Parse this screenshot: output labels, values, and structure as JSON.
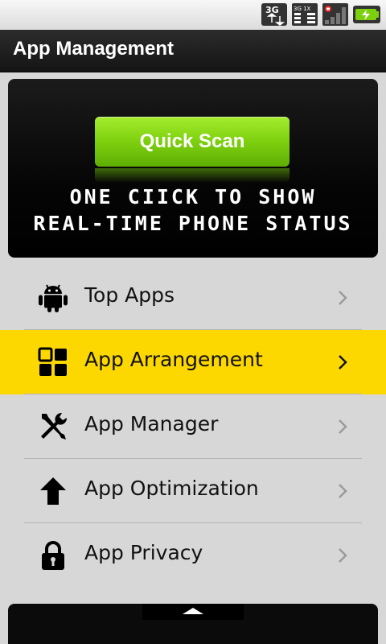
{
  "status_bar": {
    "network_icon": "3g-icon",
    "data_icon": "data-3g-1x-icon",
    "signal_icon": "signal-icon",
    "battery_icon": "battery-charging-icon"
  },
  "header": {
    "title": "App Management"
  },
  "scan_panel": {
    "button_label": "Quick Scan",
    "line1": "ONE CIICK TO SHOW",
    "line2": "REAL-TIME PHONE STATUS"
  },
  "menu": {
    "items": [
      {
        "label": "Top Apps",
        "icon": "android-icon",
        "highlighted": false
      },
      {
        "label": "App Arrangement",
        "icon": "grid-icon",
        "highlighted": true
      },
      {
        "label": "App Manager",
        "icon": "tools-icon",
        "highlighted": false
      },
      {
        "label": "App Optimization",
        "icon": "arrow-up-icon",
        "highlighted": false
      },
      {
        "label": "App Privacy",
        "icon": "lock-icon",
        "highlighted": false
      }
    ]
  },
  "colors": {
    "accent_green": "#7dd00e",
    "highlight_yellow": "#fcd800"
  },
  "bottom_panel": {
    "handle_icon": "triangle-up-icon"
  }
}
